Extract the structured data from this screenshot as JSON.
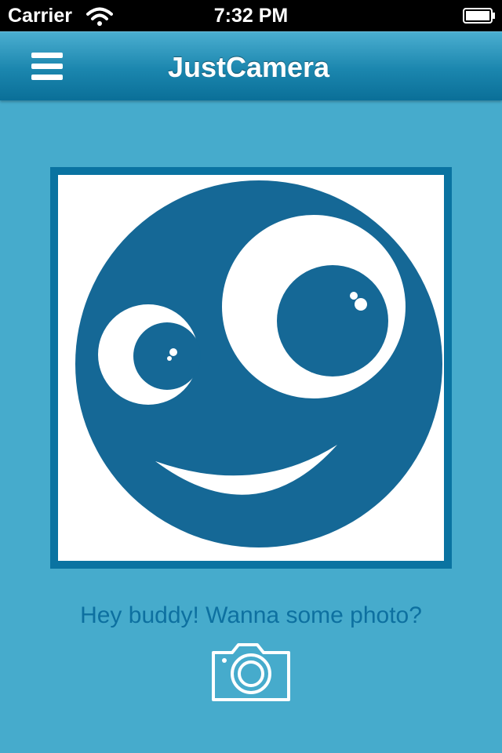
{
  "status_bar": {
    "carrier": "Carrier",
    "time": "7:32 PM",
    "icons": [
      "wifi-icon",
      "battery-icon"
    ]
  },
  "nav_bar": {
    "title": "JustCamera",
    "menu_icon": "hamburger-menu-icon"
  },
  "photo": {
    "content": "smiley-face-illustration",
    "colors": {
      "face": "#156896",
      "frame": "#0a73a1",
      "background": "#ffffff"
    }
  },
  "main": {
    "prompt": "Hey buddy! Wanna some photo?",
    "camera_icon": "camera-icon"
  },
  "colors": {
    "page_background": "#46abcc",
    "nav_gradient_top": "#4aaed0",
    "nav_gradient_bottom": "#0a6f98",
    "prompt_text": "#0d70a0"
  }
}
